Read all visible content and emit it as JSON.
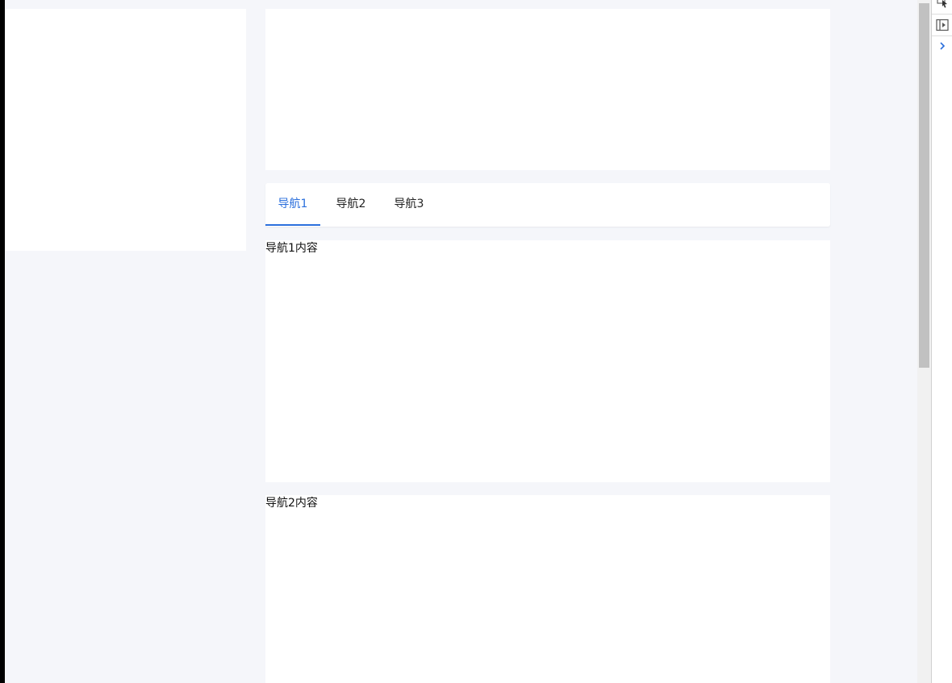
{
  "tabs": [
    {
      "label": "导航1",
      "active": true
    },
    {
      "label": "导航2",
      "active": false
    },
    {
      "label": "导航3",
      "active": false
    }
  ],
  "sections": [
    {
      "text": "导航1内容"
    },
    {
      "text": "导航2内容"
    }
  ],
  "colors": {
    "accent": "#2b6fdc",
    "page_background": "#f5f6fa",
    "card_background": "#ffffff"
  },
  "devtools_icons": [
    "inspect-element-icon",
    "toggle-device-icon",
    "expand-chevron-icon"
  ]
}
